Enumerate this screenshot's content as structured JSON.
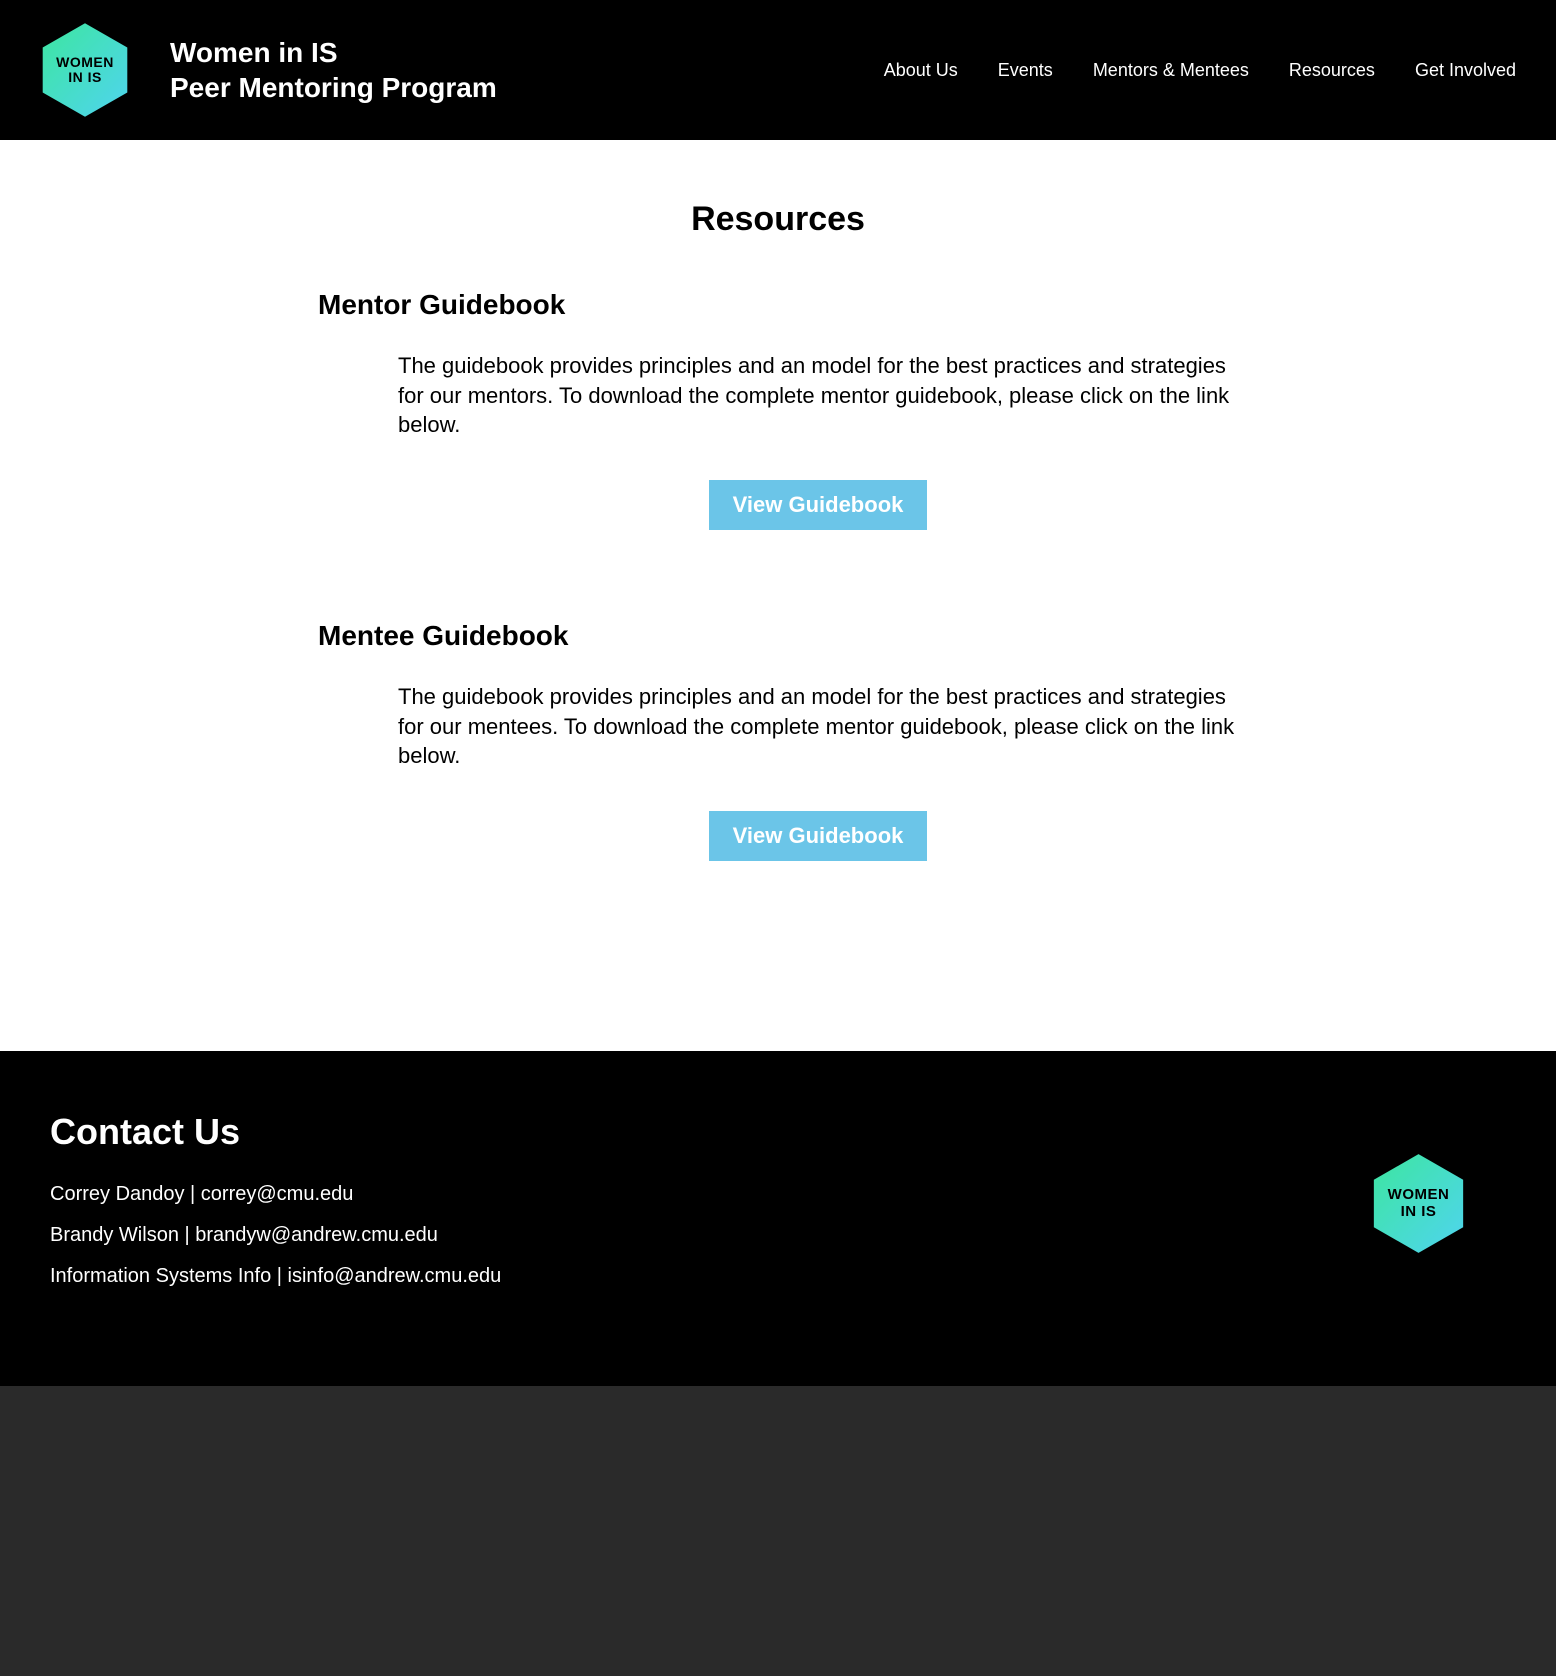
{
  "header": {
    "logo_line1": "WOMEN",
    "logo_line2": "IN IS",
    "title_line1": "Women in IS",
    "title_line2": "Peer Mentoring Program",
    "nav": {
      "about": "About Us",
      "events": "Events",
      "mentors": "Mentors & Mentees",
      "resources": "Resources",
      "involved": "Get Involved"
    }
  },
  "page": {
    "title": "Resources",
    "sections": [
      {
        "heading": "Mentor Guidebook",
        "text": "The guidebook provides principles and an model for the best practices and strategies for our mentors. To download the complete mentor guidebook, please click on the link below.",
        "button": "View Guidebook"
      },
      {
        "heading": "Mentee Guidebook",
        "text": "The guidebook provides principles and an model for the best practices and strategies for our mentees. To download the complete mentor guidebook, please click on the link below.",
        "button": "View Guidebook"
      }
    ]
  },
  "footer": {
    "heading": "Contact Us",
    "contacts": [
      "Correy Dandoy | correy@cmu.edu",
      "Brandy Wilson | brandyw@andrew.cmu.edu",
      "Information Systems Info | isinfo@andrew.cmu.edu"
    ],
    "logo_line1": "WOMEN",
    "logo_line2": "IN IS"
  },
  "colors": {
    "accent_button": "#6bc5e8",
    "hex_top": "#3de6a0",
    "hex_bottom": "#4fd4ef"
  }
}
